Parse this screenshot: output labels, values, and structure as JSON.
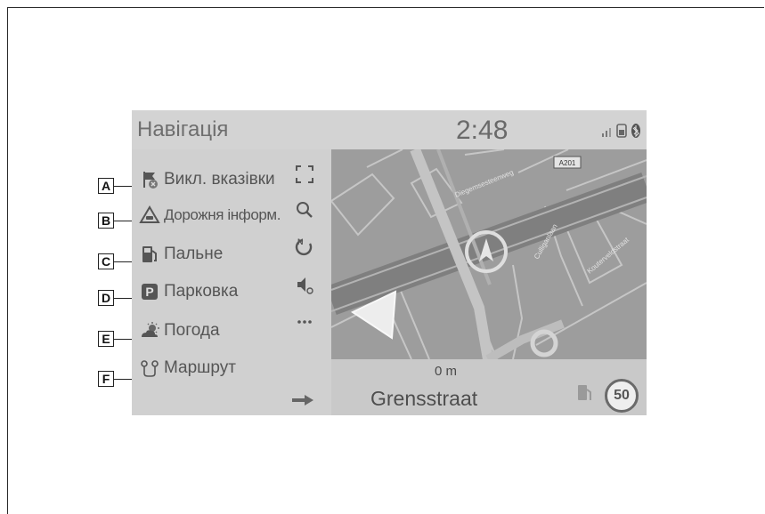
{
  "screen": {
    "title": "Навігація",
    "clock": "2:48",
    "distance": "0 m",
    "street": "Grensstraat",
    "speed_limit": "50",
    "road_badge": "A201"
  },
  "menu": [
    {
      "callout": "A",
      "label": "Викл. вказівки",
      "icon": "guidance-off-icon"
    },
    {
      "callout": "B",
      "label": "Дорожня інформ.",
      "icon": "traffic-warning-icon"
    },
    {
      "callout": "C",
      "label": "Пальне",
      "icon": "fuel-pump-icon"
    },
    {
      "callout": "D",
      "label": "Парковка",
      "icon": "parking-icon"
    },
    {
      "callout": "E",
      "label": "Погода",
      "icon": "weather-icon"
    },
    {
      "callout": "F",
      "label": "Маршрут",
      "icon": "route-icon"
    }
  ],
  "tools": [
    "fullscreen-icon",
    "search-icon",
    "map-orientation-icon",
    "voice-volume-icon",
    "more-icon"
  ],
  "map_labels": {
    "street_1": "Diegemsesteenweg",
    "street_2": "Culliganlaan",
    "street_3": "Kouterveldstraat"
  },
  "colors": {
    "screen_bg": "#c9c9c9",
    "map_bg": "#9d9d9d",
    "text": "#555555"
  }
}
